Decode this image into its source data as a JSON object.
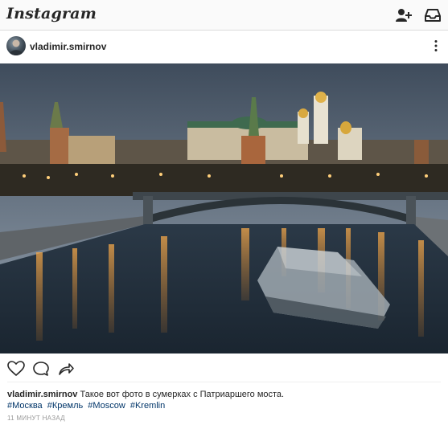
{
  "app": {
    "name": "Instagram"
  },
  "topbar": {
    "add_user_icon": "add-user-icon",
    "inbox_icon": "inbox-icon"
  },
  "post": {
    "username": "vladimir.smirnov",
    "more_icon": "more-vertical-icon",
    "photo_description_icons": "kremlin-night-photo",
    "actions": [
      "heart-icon",
      "comment-icon",
      "share-icon"
    ],
    "caption_username": "vladimir.smirnov",
    "caption_text": "Такое вот фото в сумерках с Патриаршего моста.",
    "hashtags": [
      "#Москва",
      "#Кремль",
      "#Moscow",
      "#Kremlin"
    ],
    "timestamp": "11 МИНУТ НАЗАД"
  },
  "colors": {
    "hashtag": "#003569",
    "text": "#262626",
    "muted": "#999999",
    "topbar_bg": "#fafafa",
    "border": "#dbdbdb"
  }
}
